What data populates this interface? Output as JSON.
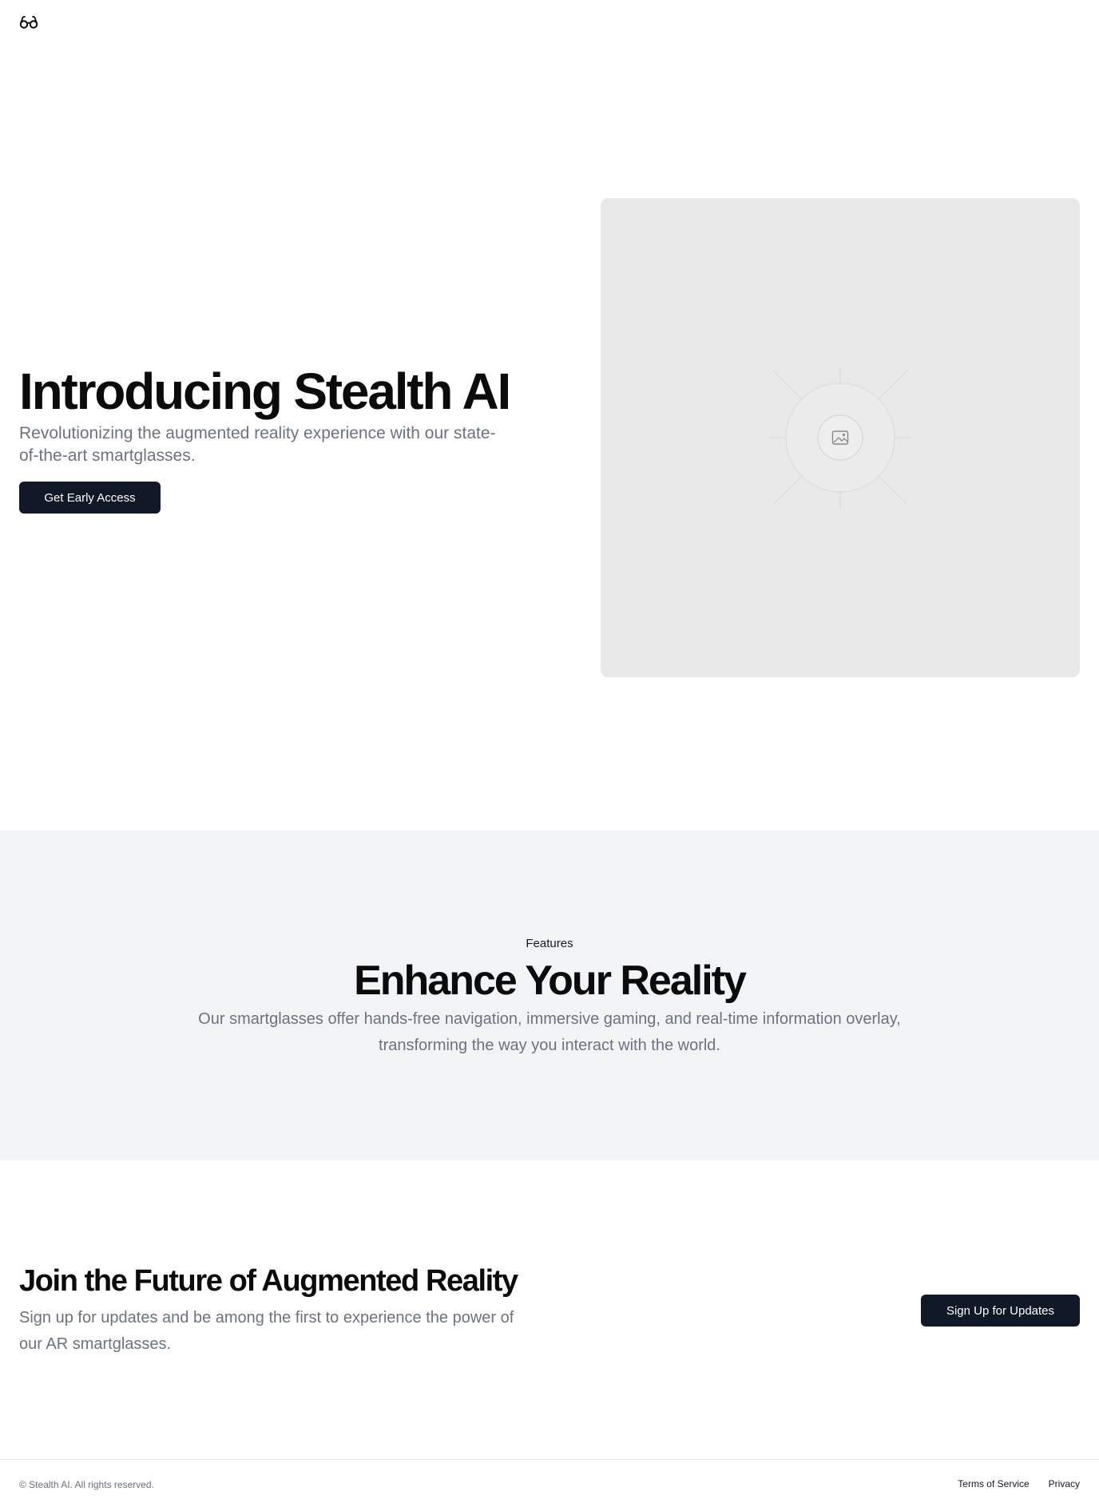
{
  "header": {
    "logo_icon": "glasses-icon"
  },
  "hero": {
    "title": "Introducing Stealth AI",
    "subtitle": "Revolutionizing the augmented reality experience with our state-of-the-art smartglasses.",
    "cta_label": "Get Early Access",
    "image_placeholder_icon": "image-icon"
  },
  "features": {
    "eyebrow": "Features",
    "title": "Enhance Your Reality",
    "description": "Our smartglasses offer hands-free navigation, immersive gaming, and real-time information overlay, transforming the way you interact with the world."
  },
  "cta": {
    "title": "Join the Future of Augmented Reality",
    "subtitle": "Sign up for updates and be among the first to experience the power of our AR smartglasses.",
    "button_label": "Sign Up for Updates"
  },
  "footer": {
    "copyright": "© Stealth AI. All rights reserved.",
    "links": [
      {
        "label": "Terms of Service"
      },
      {
        "label": "Privacy"
      }
    ]
  },
  "colors": {
    "primary_button": "#111827",
    "muted_text": "#6b7280",
    "features_bg": "#f2f3f4",
    "placeholder_bg": "#e8e8e8"
  }
}
